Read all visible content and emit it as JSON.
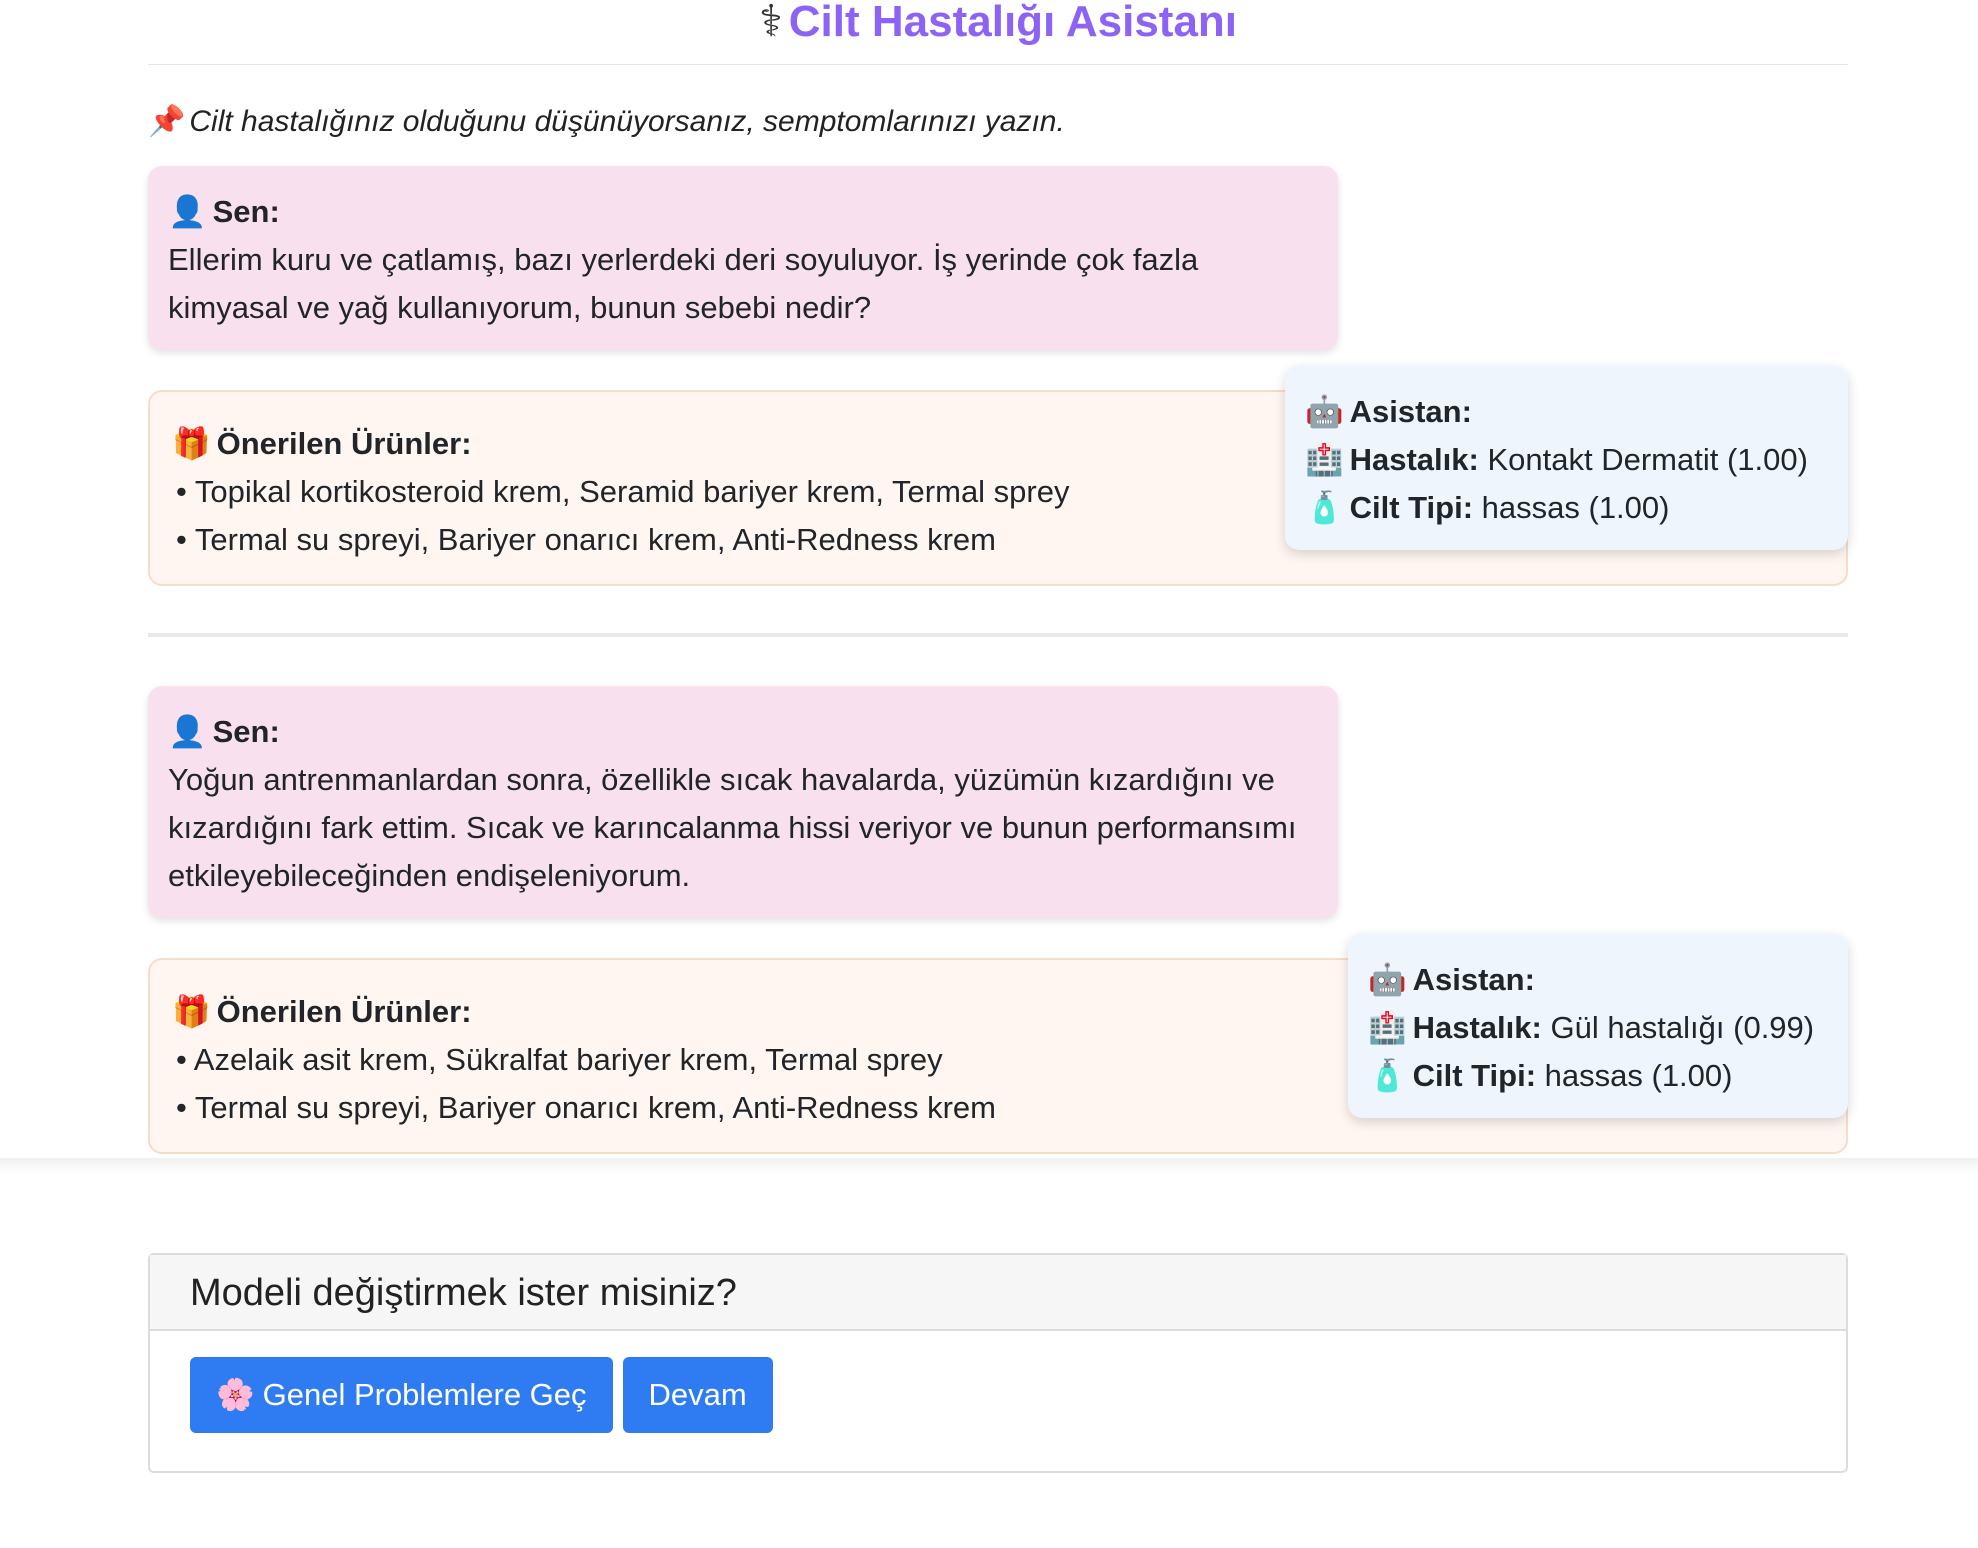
{
  "header": {
    "icon": "stethoscope-icon",
    "title": "Cilt Hastalığı Asistanı"
  },
  "intro": {
    "icon": "pushpin-icon",
    "text": "Cilt hastalığınız olduğunu düşünüyorsanız, semptomlarınızı yazın."
  },
  "conversations": [
    {
      "user": {
        "label": "Sen:",
        "text": "Ellerim kuru ve çatlamış, bazı yerlerdeki deri soyuluyor. İş yerinde çok fazla kimyasal ve yağ kullanıyorum, bunun sebebi nedir?"
      },
      "products": {
        "label": "Önerilen Ürünler:",
        "lines": [
          "Topikal kortikosteroid krem, Seramid bariyer krem, Termal sprey",
          "Termal su spreyi, Bariyer onarıcı krem, Anti-Redness krem"
        ]
      },
      "assistant": {
        "label": "Asistan:",
        "disease_label": "Hastalık:",
        "disease_value": "Kontakt Dermatit (1.00)",
        "skin_label": "Cilt Tipi:",
        "skin_value": "hassas (1.00)"
      }
    },
    {
      "user": {
        "label": "Sen:",
        "text": "Yoğun antrenmanlardan sonra, özellikle sıcak havalarda, yüzümün kızardığını ve kızardığını fark ettim. Sıcak ve karıncalanma hissi veriyor ve bunun performansımı etkileyebileceğinden endişeleniyorum."
      },
      "products": {
        "label": "Önerilen Ürünler:",
        "lines": [
          "Azelaik asit krem, Sükralfat bariyer krem, Termal sprey",
          "Termal su spreyi, Bariyer onarıcı krem, Anti-Redness krem"
        ]
      },
      "assistant": {
        "label": "Asistan:",
        "disease_label": "Hastalık:",
        "disease_value": "Gül hastalığı (0.99)",
        "skin_label": "Cilt Tipi:",
        "skin_value": "hassas (1.00)"
      }
    }
  ],
  "model_card": {
    "title": "Modeli değiştirmek ister misiniz?",
    "switch_button": {
      "icon": "cherry-blossom-icon",
      "label": "Genel Problemlere Geç"
    },
    "continue_button": {
      "label": "Devam"
    }
  },
  "colors": {
    "title": "#8c63f5",
    "user_bubble": "#f8e0ef",
    "products_box": "#fff6f1",
    "assistant_box": "#eef5fd",
    "button": "#2f7cf2"
  }
}
